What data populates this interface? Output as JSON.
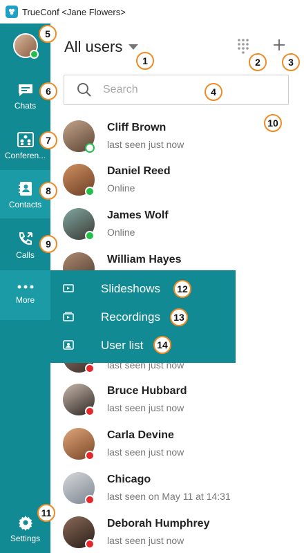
{
  "window": {
    "title": "TrueConf <Jane Flowers>"
  },
  "sidebar": {
    "me_presence_color": "#22c04a",
    "items": [
      {
        "label": "Chats",
        "icon": "chat-icon"
      },
      {
        "label": "Conferen...",
        "icon": "conference-icon"
      },
      {
        "label": "Contacts",
        "icon": "contacts-icon",
        "active": true
      },
      {
        "label": "Calls",
        "icon": "calls-icon"
      },
      {
        "label": "More",
        "icon": "more-icon"
      }
    ],
    "settings_label": "Settings"
  },
  "header": {
    "filter_label": "All users"
  },
  "search": {
    "placeholder": "Search"
  },
  "contacts": [
    {
      "name": "Cliff Brown",
      "status": "last seen just now",
      "presence": "offline-hollow"
    },
    {
      "name": "Daniel Reed",
      "status": "Online",
      "presence": "online"
    },
    {
      "name": "James Wolf",
      "status": "Online",
      "presence": "online"
    },
    {
      "name": "William Hayes",
      "status": ""
    },
    {
      "name": "",
      "status": "last seen just now",
      "presence": "busy"
    },
    {
      "name": "Bruce Hubbard",
      "status": "last seen just now",
      "presence": "busy"
    },
    {
      "name": "Carla Devine",
      "status": "last seen just now",
      "presence": "busy"
    },
    {
      "name": "Chicago",
      "status": "last seen on May 11 at 14:31",
      "presence": "busy"
    },
    {
      "name": "Deborah Humphrey",
      "status": "last seen just now",
      "presence": "busy"
    }
  ],
  "more_menu": [
    {
      "label": "Slideshows",
      "icon": "slideshow-icon"
    },
    {
      "label": "Recordings",
      "icon": "recordings-icon"
    },
    {
      "label": "User list",
      "icon": "user-list-icon"
    }
  ],
  "callouts": [
    "1",
    "2",
    "3",
    "4",
    "5",
    "6",
    "7",
    "8",
    "9",
    "10",
    "11",
    "12",
    "13",
    "14"
  ],
  "colors": {
    "sidebar": "#128a93",
    "online": "#22c04a",
    "busy": "#e5262a",
    "callout_border": "#f08a24"
  }
}
